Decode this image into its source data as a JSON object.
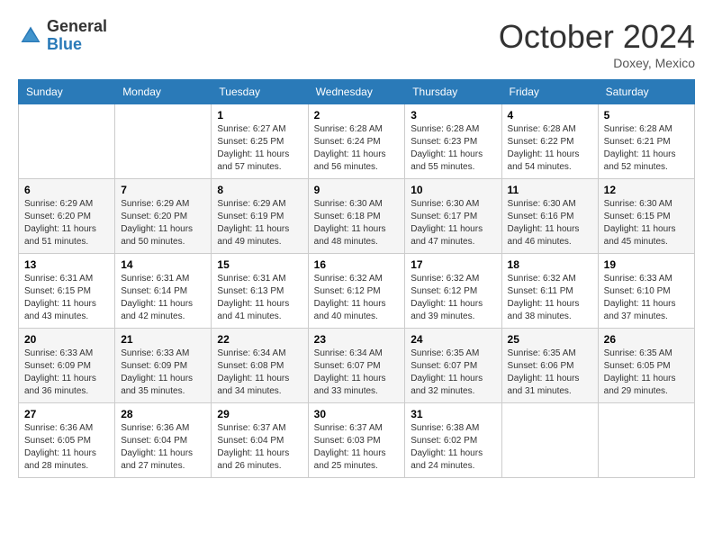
{
  "header": {
    "logo_general": "General",
    "logo_blue": "Blue",
    "month_title": "October 2024",
    "location": "Doxey, Mexico"
  },
  "weekdays": [
    "Sunday",
    "Monday",
    "Tuesday",
    "Wednesday",
    "Thursday",
    "Friday",
    "Saturday"
  ],
  "weeks": [
    [
      {
        "day": "",
        "info": ""
      },
      {
        "day": "",
        "info": ""
      },
      {
        "day": "1",
        "info": "Sunrise: 6:27 AM\nSunset: 6:25 PM\nDaylight: 11 hours and 57 minutes."
      },
      {
        "day": "2",
        "info": "Sunrise: 6:28 AM\nSunset: 6:24 PM\nDaylight: 11 hours and 56 minutes."
      },
      {
        "day": "3",
        "info": "Sunrise: 6:28 AM\nSunset: 6:23 PM\nDaylight: 11 hours and 55 minutes."
      },
      {
        "day": "4",
        "info": "Sunrise: 6:28 AM\nSunset: 6:22 PM\nDaylight: 11 hours and 54 minutes."
      },
      {
        "day": "5",
        "info": "Sunrise: 6:28 AM\nSunset: 6:21 PM\nDaylight: 11 hours and 52 minutes."
      }
    ],
    [
      {
        "day": "6",
        "info": "Sunrise: 6:29 AM\nSunset: 6:20 PM\nDaylight: 11 hours and 51 minutes."
      },
      {
        "day": "7",
        "info": "Sunrise: 6:29 AM\nSunset: 6:20 PM\nDaylight: 11 hours and 50 minutes."
      },
      {
        "day": "8",
        "info": "Sunrise: 6:29 AM\nSunset: 6:19 PM\nDaylight: 11 hours and 49 minutes."
      },
      {
        "day": "9",
        "info": "Sunrise: 6:30 AM\nSunset: 6:18 PM\nDaylight: 11 hours and 48 minutes."
      },
      {
        "day": "10",
        "info": "Sunrise: 6:30 AM\nSunset: 6:17 PM\nDaylight: 11 hours and 47 minutes."
      },
      {
        "day": "11",
        "info": "Sunrise: 6:30 AM\nSunset: 6:16 PM\nDaylight: 11 hours and 46 minutes."
      },
      {
        "day": "12",
        "info": "Sunrise: 6:30 AM\nSunset: 6:15 PM\nDaylight: 11 hours and 45 minutes."
      }
    ],
    [
      {
        "day": "13",
        "info": "Sunrise: 6:31 AM\nSunset: 6:15 PM\nDaylight: 11 hours and 43 minutes."
      },
      {
        "day": "14",
        "info": "Sunrise: 6:31 AM\nSunset: 6:14 PM\nDaylight: 11 hours and 42 minutes."
      },
      {
        "day": "15",
        "info": "Sunrise: 6:31 AM\nSunset: 6:13 PM\nDaylight: 11 hours and 41 minutes."
      },
      {
        "day": "16",
        "info": "Sunrise: 6:32 AM\nSunset: 6:12 PM\nDaylight: 11 hours and 40 minutes."
      },
      {
        "day": "17",
        "info": "Sunrise: 6:32 AM\nSunset: 6:12 PM\nDaylight: 11 hours and 39 minutes."
      },
      {
        "day": "18",
        "info": "Sunrise: 6:32 AM\nSunset: 6:11 PM\nDaylight: 11 hours and 38 minutes."
      },
      {
        "day": "19",
        "info": "Sunrise: 6:33 AM\nSunset: 6:10 PM\nDaylight: 11 hours and 37 minutes."
      }
    ],
    [
      {
        "day": "20",
        "info": "Sunrise: 6:33 AM\nSunset: 6:09 PM\nDaylight: 11 hours and 36 minutes."
      },
      {
        "day": "21",
        "info": "Sunrise: 6:33 AM\nSunset: 6:09 PM\nDaylight: 11 hours and 35 minutes."
      },
      {
        "day": "22",
        "info": "Sunrise: 6:34 AM\nSunset: 6:08 PM\nDaylight: 11 hours and 34 minutes."
      },
      {
        "day": "23",
        "info": "Sunrise: 6:34 AM\nSunset: 6:07 PM\nDaylight: 11 hours and 33 minutes."
      },
      {
        "day": "24",
        "info": "Sunrise: 6:35 AM\nSunset: 6:07 PM\nDaylight: 11 hours and 32 minutes."
      },
      {
        "day": "25",
        "info": "Sunrise: 6:35 AM\nSunset: 6:06 PM\nDaylight: 11 hours and 31 minutes."
      },
      {
        "day": "26",
        "info": "Sunrise: 6:35 AM\nSunset: 6:05 PM\nDaylight: 11 hours and 29 minutes."
      }
    ],
    [
      {
        "day": "27",
        "info": "Sunrise: 6:36 AM\nSunset: 6:05 PM\nDaylight: 11 hours and 28 minutes."
      },
      {
        "day": "28",
        "info": "Sunrise: 6:36 AM\nSunset: 6:04 PM\nDaylight: 11 hours and 27 minutes."
      },
      {
        "day": "29",
        "info": "Sunrise: 6:37 AM\nSunset: 6:04 PM\nDaylight: 11 hours and 26 minutes."
      },
      {
        "day": "30",
        "info": "Sunrise: 6:37 AM\nSunset: 6:03 PM\nDaylight: 11 hours and 25 minutes."
      },
      {
        "day": "31",
        "info": "Sunrise: 6:38 AM\nSunset: 6:02 PM\nDaylight: 11 hours and 24 minutes."
      },
      {
        "day": "",
        "info": ""
      },
      {
        "day": "",
        "info": ""
      }
    ]
  ]
}
